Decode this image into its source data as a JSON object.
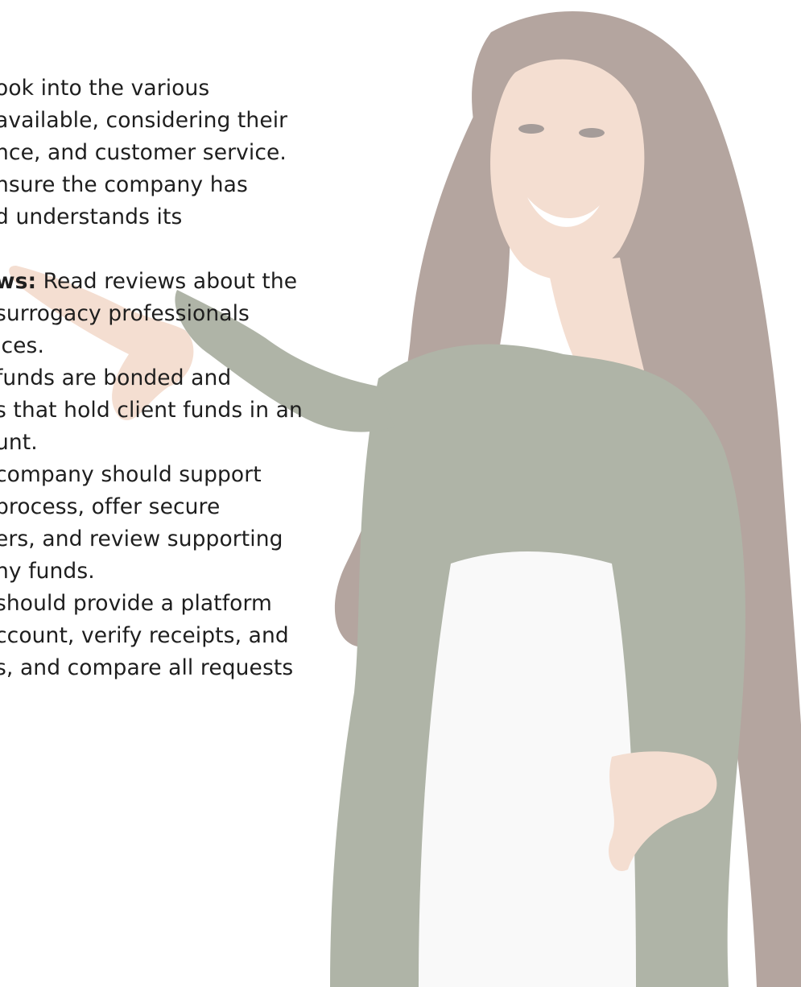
{
  "lines": [
    "ook into the various",
    "available, considering their",
    "nce, and customer service.",
    "nsure the company has",
    "d understands its",
    "",
    {
      "bold": "ws:",
      "rest": " Read reviews about the"
    },
    "surrogacy professionals",
    "ices.",
    "funds are bonded and",
    "s that hold client funds in an",
    "unt.",
    "company should support",
    "process, offer secure",
    "ers, and review supporting",
    "ny funds.",
    "should provide a platform",
    "ccount, verify receipts, and",
    "s, and compare all requests"
  ],
  "line_offsets": [
    6,
    6,
    6,
    6,
    6,
    6,
    6,
    6,
    6,
    6,
    6,
    6,
    6,
    6,
    6,
    6,
    6,
    6,
    6
  ],
  "colors": {
    "text": "#1e1e1e",
    "hair": "#5a3a2c",
    "jacket": "#4f5a3e",
    "skin": "#e8b79a",
    "shirt": "#f3f3f3"
  }
}
